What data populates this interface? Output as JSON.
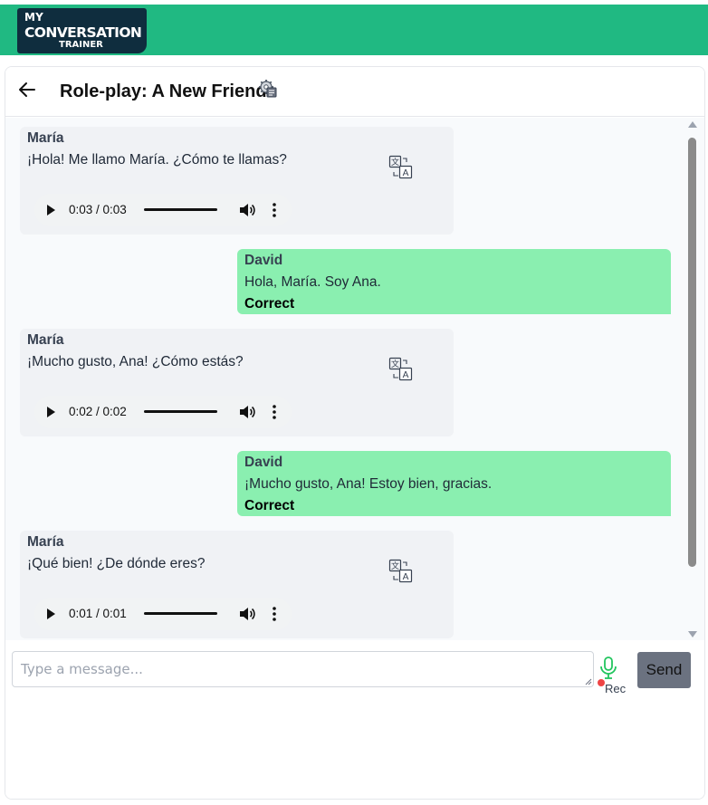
{
  "app": {
    "logo_line1": "MY",
    "logo_line2": "CONVERSATION",
    "logo_line3": "TRAINER",
    "header_color": "#20b982"
  },
  "chat": {
    "title": "Role-play: A New Friend"
  },
  "messages": [
    {
      "role": "bot",
      "sender": "María",
      "text": "¡Hola! Me llamo María. ¿Cómo te llamas?",
      "audio_time": "0:03 / 0:03"
    },
    {
      "role": "user",
      "sender": "David",
      "text": "Hola, María. Soy Ana.",
      "status": "Correct"
    },
    {
      "role": "bot",
      "sender": "María",
      "text": "¡Mucho gusto, Ana! ¿Cómo estás?",
      "audio_time": "0:02 / 0:02"
    },
    {
      "role": "user",
      "sender": "David",
      "text": "¡Mucho gusto, Ana! Estoy bien, gracias.",
      "status": "Correct"
    },
    {
      "role": "bot",
      "sender": "María",
      "text": "¡Qué bien! ¿De dónde eres?",
      "audio_time": "0:01 / 0:01"
    }
  ],
  "composer": {
    "placeholder": "Type a message...",
    "rec_label": "Rec",
    "send_label": "Send"
  },
  "colors": {
    "user_bubble": "#8aefb0",
    "bot_bubble": "#f0f2f5",
    "send_button": "#6b7280",
    "mic": "#22c55e",
    "rec_dot": "#ef4444"
  }
}
